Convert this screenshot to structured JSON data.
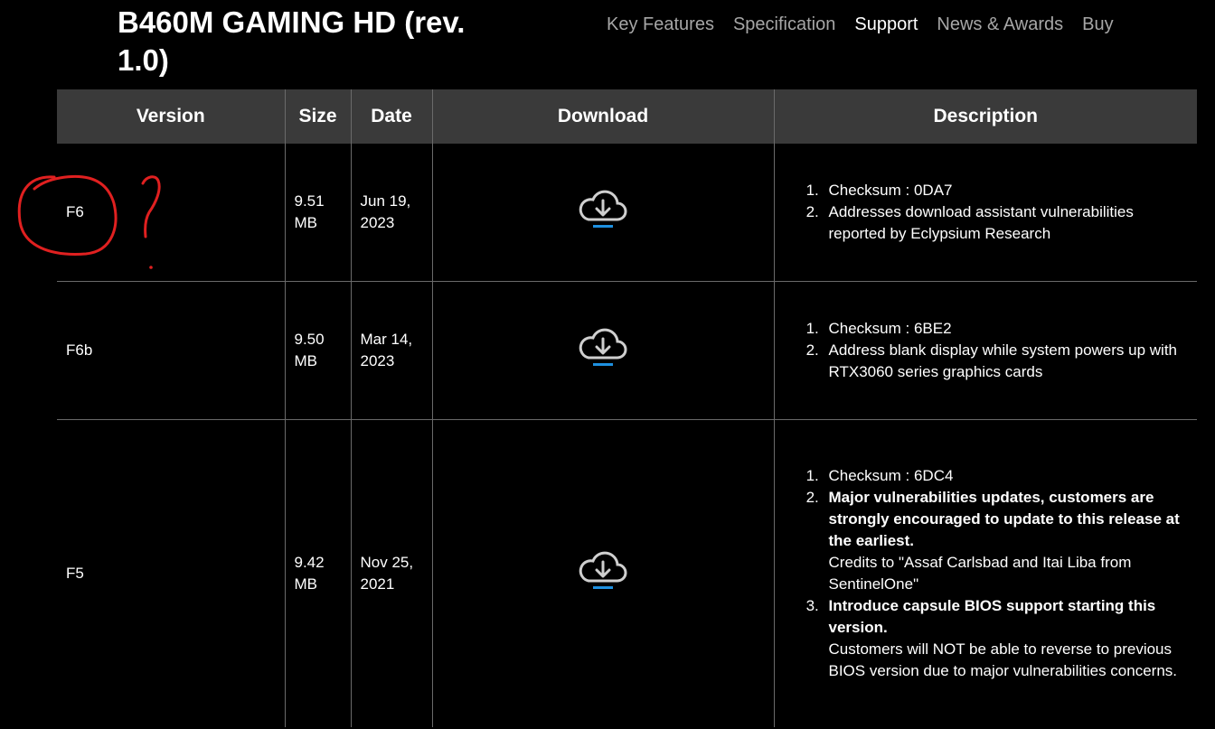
{
  "header": {
    "title": "B460M GAMING HD (rev. 1.0)",
    "nav": [
      {
        "label": "Key Features",
        "active": false
      },
      {
        "label": "Specification",
        "active": false
      },
      {
        "label": "Support",
        "active": true
      },
      {
        "label": "News & Awards",
        "active": false
      },
      {
        "label": "Buy",
        "active": false
      }
    ]
  },
  "table": {
    "columns": [
      "Version",
      "Size",
      "Date",
      "Download",
      "Description"
    ],
    "rows": [
      {
        "version": "F6",
        "size": "9.51 MB",
        "date": "Jun 19, 2023",
        "download_icon": "cloud-download-icon",
        "description": [
          {
            "text": "Checksum : 0DA7"
          },
          {
            "text": "Addresses download assistant vulnerabilities reported by Eclypsium Research"
          }
        ]
      },
      {
        "version": "F6b",
        "size": "9.50 MB",
        "date": "Mar 14, 2023",
        "download_icon": "cloud-download-icon",
        "description": [
          {
            "text": "Checksum : 6BE2"
          },
          {
            "text": "Address blank display while system powers up with RTX3060 series graphics cards"
          }
        ]
      },
      {
        "version": "F5",
        "size": "9.42 MB",
        "date": "Nov 25, 2021",
        "download_icon": "cloud-download-icon",
        "description": [
          {
            "text": "Checksum : 6DC4"
          },
          {
            "bold": "Major vulnerabilities updates, customers are strongly encouraged to update to this release at the earliest.",
            "note": "Credits to \"Assaf Carlsbad and Itai Liba from SentinelOne\""
          },
          {
            "bold": "Introduce capsule BIOS support starting this version.",
            "note": "Customers will NOT be able to reverse to previous BIOS version due to major vulnerabilities concerns."
          }
        ]
      }
    ]
  },
  "colors": {
    "background": "#000000",
    "header_bg": "#3a3a3a",
    "nav_inactive": "#a6a6a6",
    "download_accent": "#1e90e0",
    "annotation_red": "#e02020"
  }
}
